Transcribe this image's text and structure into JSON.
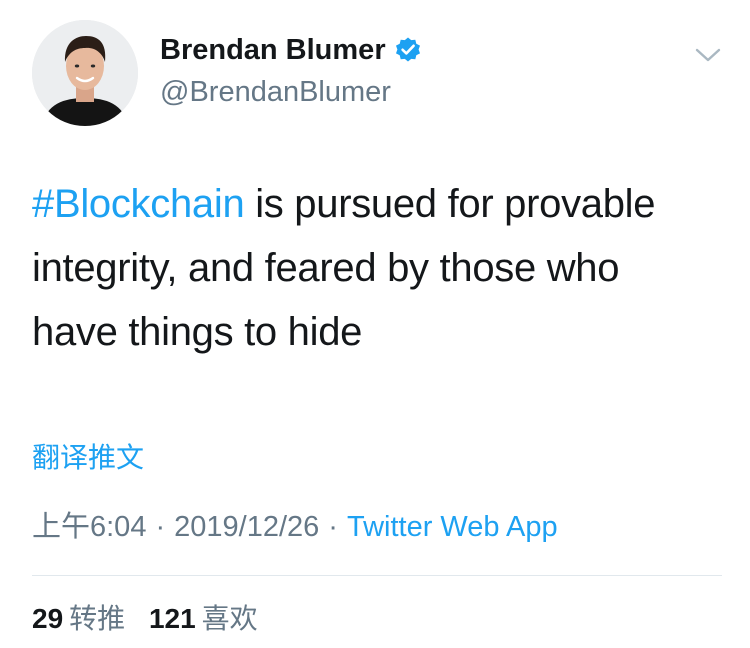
{
  "author": {
    "display_name": "Brendan Blumer",
    "handle": "@BrendanBlumer",
    "verified": true
  },
  "tweet": {
    "hashtag": "#Blockchain",
    "text_rest_line1": " is pursued for provable",
    "text_line2": "integrity, and feared by those who",
    "text_line3": "have things to hide"
  },
  "translate_label": "翻译推文",
  "meta": {
    "time": "上午6:04",
    "separator": "·",
    "date": "2019/12/26",
    "source": "Twitter Web App"
  },
  "stats": {
    "retweets_count": "29",
    "retweets_label": "转推",
    "likes_count": "121",
    "likes_label": "喜欢"
  },
  "icons": {
    "verified": "verified-badge-icon",
    "caret": "chevron-down-icon"
  },
  "colors": {
    "accent": "#1da1f2",
    "text_primary": "#14171a",
    "text_secondary": "#657786",
    "divider": "#e1e8ed"
  }
}
